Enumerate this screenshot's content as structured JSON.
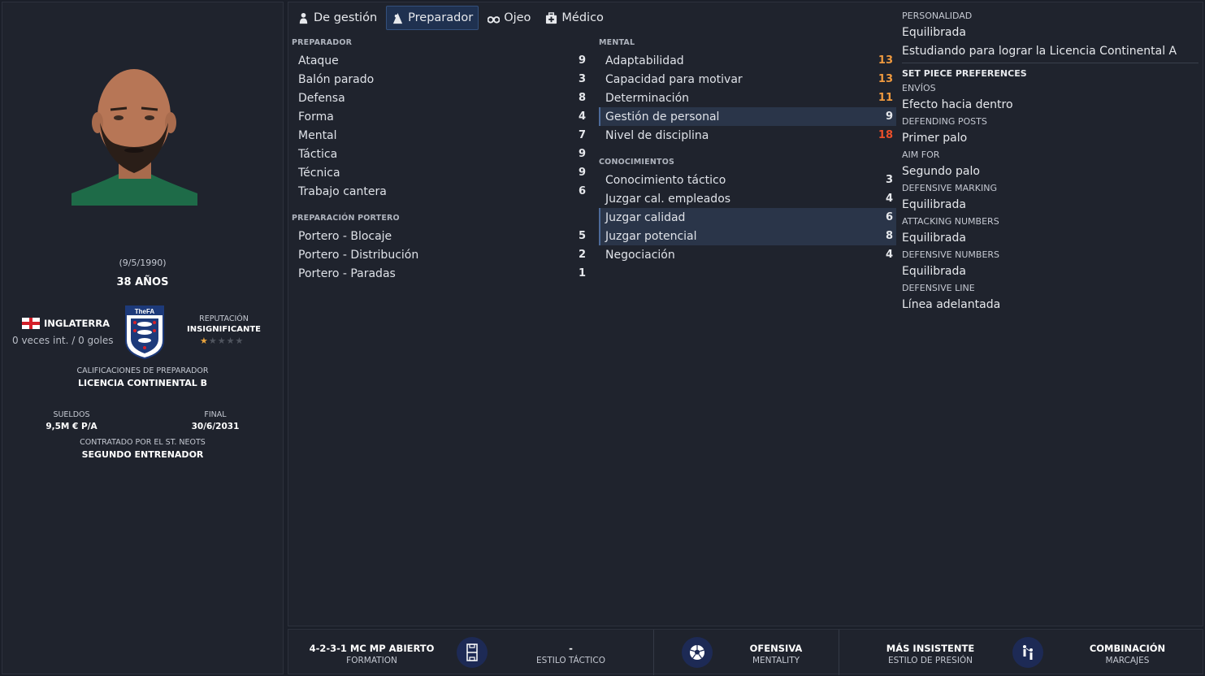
{
  "profile": {
    "dob": "(9/5/1990)",
    "age": "38 AÑOS",
    "nation": "INGLATERRA",
    "caps": "0 veces int. / 0 goles",
    "reputation_label": "REPUTACIÓN",
    "reputation_value": "INSIGNIFICANTE",
    "reputation_stars": 1,
    "reputation_stars_max": 5,
    "qualification_label": "CALIFICACIONES DE PREPARADOR",
    "qualification_value": "LICENCIA CONTINENTAL B",
    "wage_label": "SUELDOS",
    "wage_value": "9,5M € P/A",
    "end_label": "FINAL",
    "end_value": "30/6/2031",
    "contract_label": "CONTRATADO POR EL ST. NEOTS",
    "contract_value": "SEGUNDO ENTRENADOR",
    "fa_logo_text": "TheFA"
  },
  "tabs": [
    {
      "label": "De gestión",
      "icon": "manager-icon",
      "active": false
    },
    {
      "label": "Preparador",
      "icon": "coach-icon",
      "active": true
    },
    {
      "label": "Ojeo",
      "icon": "binoculars-icon",
      "active": false
    },
    {
      "label": "Médico",
      "icon": "medical-kit-icon",
      "active": false
    }
  ],
  "sections": {
    "preparador": {
      "title": "PREPARADOR",
      "rows": [
        {
          "label": "Ataque",
          "value": "9"
        },
        {
          "label": "Balón parado",
          "value": "3"
        },
        {
          "label": "Defensa",
          "value": "8"
        },
        {
          "label": "Forma",
          "value": "4"
        },
        {
          "label": "Mental",
          "value": "7"
        },
        {
          "label": "Táctica",
          "value": "9"
        },
        {
          "label": "Técnica",
          "value": "9"
        },
        {
          "label": "Trabajo cantera",
          "value": "6"
        }
      ]
    },
    "portero": {
      "title": "PREPARACIÓN PORTERO",
      "rows": [
        {
          "label": "Portero - Blocaje",
          "value": "5"
        },
        {
          "label": "Portero - Distribución",
          "value": "2"
        },
        {
          "label": "Portero - Paradas",
          "value": "1"
        }
      ]
    },
    "mental": {
      "title": "MENTAL",
      "rows": [
        {
          "label": "Adaptabilidad",
          "value": "13",
          "tone": "orange"
        },
        {
          "label": "Capacidad para motivar",
          "value": "13",
          "tone": "orange"
        },
        {
          "label": "Determinación",
          "value": "11",
          "tone": "orange"
        },
        {
          "label": "Gestión de personal",
          "value": "9",
          "highlight": true
        },
        {
          "label": "Nivel de disciplina",
          "value": "18",
          "tone": "red"
        }
      ]
    },
    "conocimientos": {
      "title": "CONOCIMIENTOS",
      "rows": [
        {
          "label": "Conocimiento táctico",
          "value": "3"
        },
        {
          "label": "Juzgar cal. empleados",
          "value": "4"
        },
        {
          "label": "Juzgar calidad",
          "value": "6",
          "highlight": true
        },
        {
          "label": "Juzgar potencial",
          "value": "8",
          "highlight": true
        },
        {
          "label": "Negociación",
          "value": "4"
        }
      ]
    }
  },
  "right_info": {
    "personality_label": "PERSONALIDAD",
    "personality_value": "Equilibrada",
    "studying": "Estudiando para lograr la Licencia Continental A",
    "set_piece_title": "SET PIECE PREFERENCES",
    "items": [
      {
        "label": "ENVÍOS",
        "value": "Efecto hacia dentro"
      },
      {
        "label": "DEFENDING POSTS",
        "value": "Primer palo"
      },
      {
        "label": "AIM FOR",
        "value": "Segundo palo"
      },
      {
        "label": "DEFENSIVE MARKING",
        "value": "Equilibrada"
      },
      {
        "label": "ATTACKING NUMBERS",
        "value": "Equilibrada"
      },
      {
        "label": "DEFENSIVE NUMBERS",
        "value": "Equilibrada"
      },
      {
        "label": "DEFENSIVE LINE",
        "value": "Línea adelantada"
      }
    ]
  },
  "tactic_bar": {
    "formation_value": "4-2-3-1 MC MP ABIERTO",
    "formation_label": "FORMATION",
    "style_value": "-",
    "style_label": "ESTILO TÁCTICO",
    "mentality_value": "OFENSIVA",
    "mentality_label": "MENTALITY",
    "press_value": "MÁS INSISTENTE",
    "press_label": "ESTILO DE PRESIÓN",
    "marking_value": "COMBINACIÓN",
    "marking_label": "MARCAJES"
  },
  "colors": {
    "background": "#1b1f29",
    "panel": "#1f232d",
    "active_tab": "#1f3150",
    "highlight_row": "#2a3549",
    "attr_orange": "#f09a3f",
    "attr_red": "#ea4f2a",
    "star_gold": "#e8a33d"
  }
}
